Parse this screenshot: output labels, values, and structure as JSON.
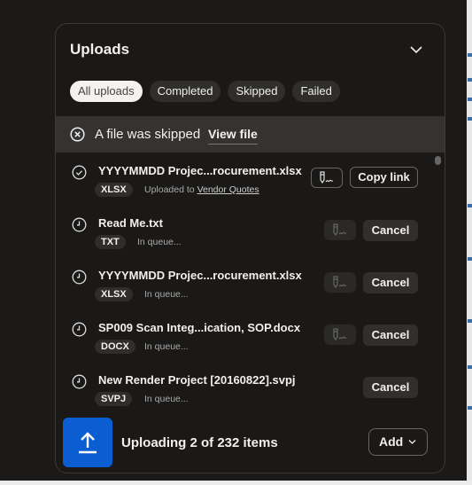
{
  "header": {
    "title": "Uploads",
    "collapse_icon": "chevron-down-icon"
  },
  "tabs": [
    {
      "label": "All uploads",
      "active": true
    },
    {
      "label": "Completed"
    },
    {
      "label": "Skipped"
    },
    {
      "label": "Failed"
    }
  ],
  "banner": {
    "message": "A file was skipped",
    "link": "View file",
    "icon": "circle-x-icon"
  },
  "items": [
    {
      "name": "YYYYMMDD Projec...rocurement.xlsx",
      "ext": "XLSX",
      "status_prefix": "Uploaded to",
      "status_link": "Vendor Quotes",
      "state": "completed",
      "action": "Copy link",
      "sign_enabled": true
    },
    {
      "name": "Read Me.txt",
      "ext": "TXT",
      "status": "In queue...",
      "state": "queued",
      "action": "Cancel",
      "sign_enabled": false
    },
    {
      "name": "YYYYMMDD Projec...rocurement.xlsx",
      "ext": "XLSX",
      "status": "In queue...",
      "state": "queued",
      "action": "Cancel",
      "sign_enabled": false
    },
    {
      "name": "SP009 Scan Integ...ication, SOP.docx",
      "ext": "DOCX",
      "status": "In queue...",
      "state": "queued",
      "action": "Cancel",
      "sign_enabled": false
    },
    {
      "name": "New Render Project [20160822].svpj",
      "ext": "SVPJ",
      "status": "In queue...",
      "state": "queued",
      "action": "Cancel"
    }
  ],
  "footer": {
    "status": "Uploading 2 of 232 items",
    "add_label": "Add",
    "accent": "#0b5ed1"
  }
}
